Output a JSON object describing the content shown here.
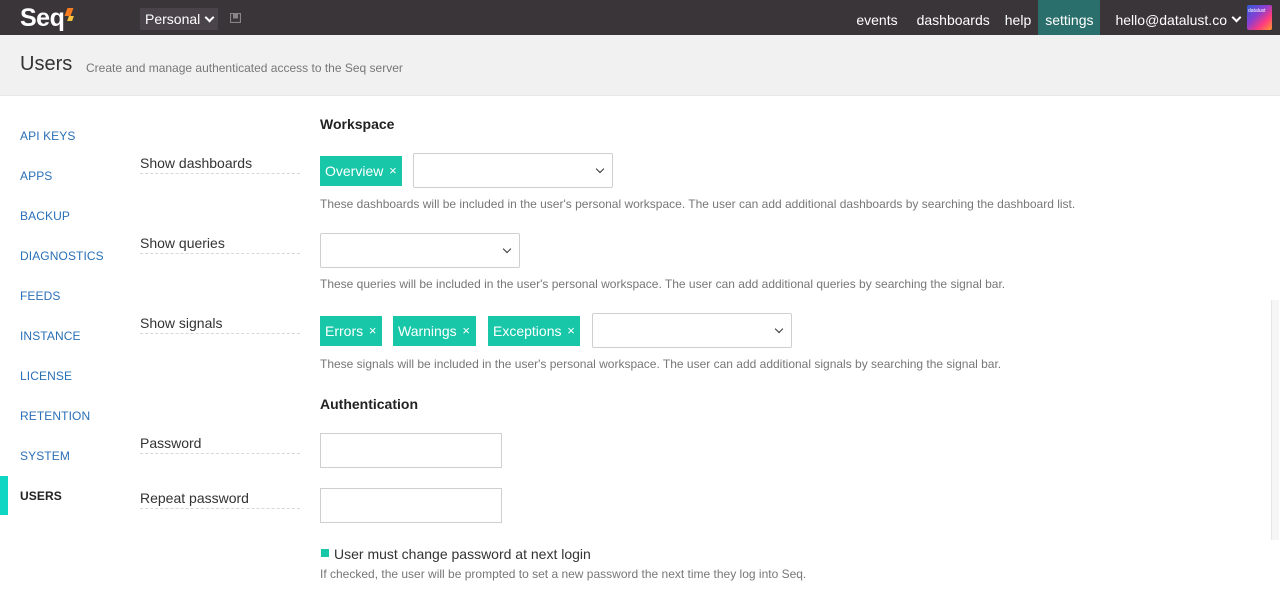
{
  "topbar": {
    "logo_text": "Seq",
    "workspace": "Personal",
    "nav": {
      "events": "events",
      "dashboards": "dashboards",
      "help": "help",
      "settings": "settings"
    },
    "user_email": "hello@datalust.co",
    "avatar_text": "datalust"
  },
  "header": {
    "title": "Users",
    "subtitle": "Create and manage authenticated access to the Seq server"
  },
  "sidebar": {
    "items": [
      {
        "label": "API KEYS"
      },
      {
        "label": "APPS"
      },
      {
        "label": "BACKUP"
      },
      {
        "label": "DIAGNOSTICS"
      },
      {
        "label": "FEEDS"
      },
      {
        "label": "INSTANCE"
      },
      {
        "label": "LICENSE"
      },
      {
        "label": "RETENTION"
      },
      {
        "label": "SYSTEM"
      },
      {
        "label": "USERS"
      }
    ],
    "active": "USERS"
  },
  "workspace": {
    "title": "Workspace",
    "dashboards": {
      "label": "Show dashboards",
      "tags": [
        "Overview"
      ],
      "help": "These dashboards will be included in the user's personal workspace. The user can add additional dashboards by searching the dashboard list."
    },
    "queries": {
      "label": "Show queries",
      "help": "These queries will be included in the user's personal workspace. The user can add additional queries by searching the signal bar."
    },
    "signals": {
      "label": "Show signals",
      "tags": [
        "Errors",
        "Warnings",
        "Exceptions"
      ],
      "help": "These signals will be included in the user's personal workspace. The user can add additional signals by searching the signal bar."
    }
  },
  "authentication": {
    "title": "Authentication",
    "password_label": "Password",
    "password_value": "",
    "repeat_password_label": "Repeat password",
    "repeat_password_value": "",
    "must_change_label": "User must change password at next login",
    "must_change_checked": true,
    "must_change_help": "If checked, the user will be prompted to set a new password the next time they log into Seq."
  },
  "tag_remove_glyph": "×",
  "colors": {
    "topbar": "#3a3539",
    "active_nav": "#2b6f6c",
    "accent": "#17c7a8",
    "sidebar_active_bar": "#0fd6c2",
    "link": "#2a6fb6"
  }
}
